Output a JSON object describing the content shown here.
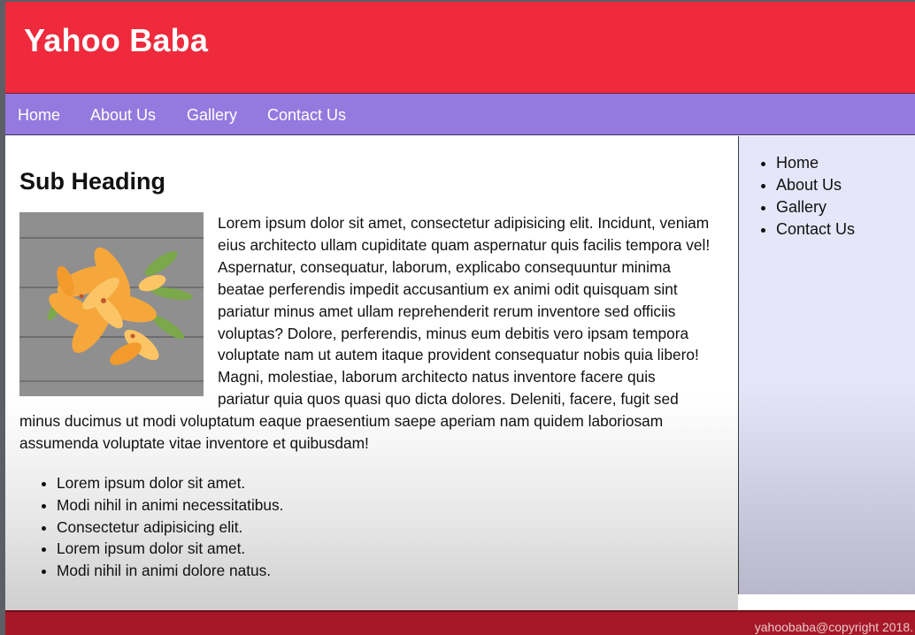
{
  "header": {
    "title": "Yahoo Baba"
  },
  "nav": {
    "items": [
      "Home",
      "About Us",
      "Gallery",
      "Contact Us"
    ]
  },
  "main": {
    "sub_heading": "Sub Heading",
    "image": "orange-lily-flowers-photo",
    "paragraph": "Lorem ipsum dolor sit amet, consectetur adipisicing elit. Incidunt, veniam eius architecto ullam cupiditate quam aspernatur quis facilis tempora vel! Aspernatur, consequatur, laborum, explicabo consequuntur minima beatae perferendis impedit accusantium ex animi odit quisquam sint pariatur minus amet ullam reprehenderit rerum inventore sed officiis voluptas? Dolore, perferendis, minus eum debitis vero ipsam tempora voluptate nam ut autem itaque provident consequatur nobis quia libero! Magni, molestiae, laborum architecto natus inventore facere quis pariatur quia quos quasi quo dicta dolores. Deleniti, facere, fugit sed minus ducimus ut modi voluptatum eaque praesentium saepe aperiam nam quidem laboriosam assumenda voluptate vitae inventore et quibusdam!",
    "bullets": [
      "Lorem ipsum dolor sit amet.",
      "Modi nihil in animi necessitatibus.",
      "Consectetur adipisicing elit.",
      "Lorem ipsum dolor sit amet.",
      "Modi nihil in animi dolore natus."
    ]
  },
  "sidebar": {
    "items": [
      "Home",
      "About Us",
      "Gallery",
      "Contact Us"
    ]
  },
  "footer": {
    "copyright": "yahoobaba@copyright 2018."
  },
  "colors": {
    "header": "#ee2a3c",
    "nav": "#9479de",
    "sidebar": "#e6e6fa",
    "footer": "#a61827"
  }
}
